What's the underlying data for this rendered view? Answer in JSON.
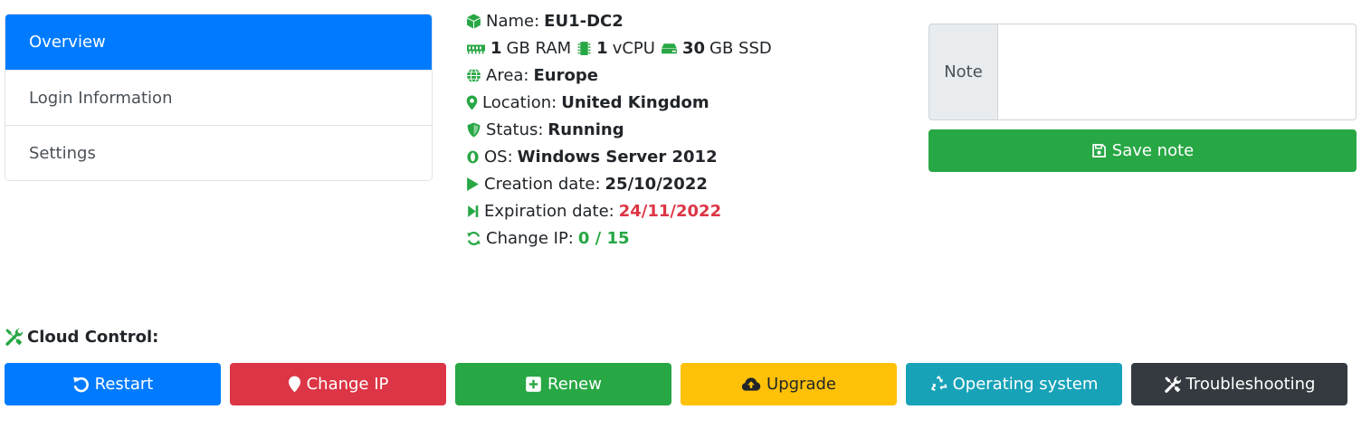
{
  "nav": {
    "items": [
      {
        "label": "Overview",
        "active": true
      },
      {
        "label": "Login Information",
        "active": false
      },
      {
        "label": "Settings",
        "active": false
      }
    ]
  },
  "info": {
    "name_label": "Name:",
    "name_value": "EU1-DC2",
    "specs": {
      "ram_value": "1",
      "ram_unit": "GB RAM",
      "cpu_value": "1",
      "cpu_unit": "vCPU",
      "ssd_value": "30",
      "ssd_unit": "GB SSD"
    },
    "area_label": "Area:",
    "area_value": "Europe",
    "location_label": "Location:",
    "location_value": "United Kingdom",
    "status_label": "Status:",
    "status_value": "Running",
    "os_label": "OS:",
    "os_value": "Windows Server 2012",
    "creation_label": "Creation date:",
    "creation_value": "25/10/2022",
    "expiration_label": "Expiration date:",
    "expiration_value": "24/11/2022",
    "change_ip_label": "Change IP:",
    "change_ip_value": "0 / 15"
  },
  "note": {
    "label": "Note",
    "value": "",
    "save_label": "Save note"
  },
  "cloud_control": {
    "title": "Cloud Control:",
    "buttons": {
      "restart": "Restart",
      "change_ip": "Change IP",
      "renew": "Renew",
      "upgrade": "Upgrade",
      "operating_system": "Operating system",
      "troubleshooting": "Troubleshooting"
    }
  },
  "colors": {
    "primary": "#007bff",
    "danger": "#dc3545",
    "success": "#28a745",
    "warning": "#ffc107",
    "info": "#17a2b8",
    "dark": "#343a40",
    "icon_green": "#28a745"
  },
  "icons": {
    "name": "cube-icon",
    "ram": "memory-icon",
    "cpu": "microchip-icon",
    "ssd": "hdd-icon",
    "area": "globe-icon",
    "location": "map-marker-icon",
    "status": "shield-icon",
    "os": "opera-icon",
    "creation": "play-icon",
    "expiration": "step-forward-icon",
    "change_ip": "sync-icon"
  }
}
